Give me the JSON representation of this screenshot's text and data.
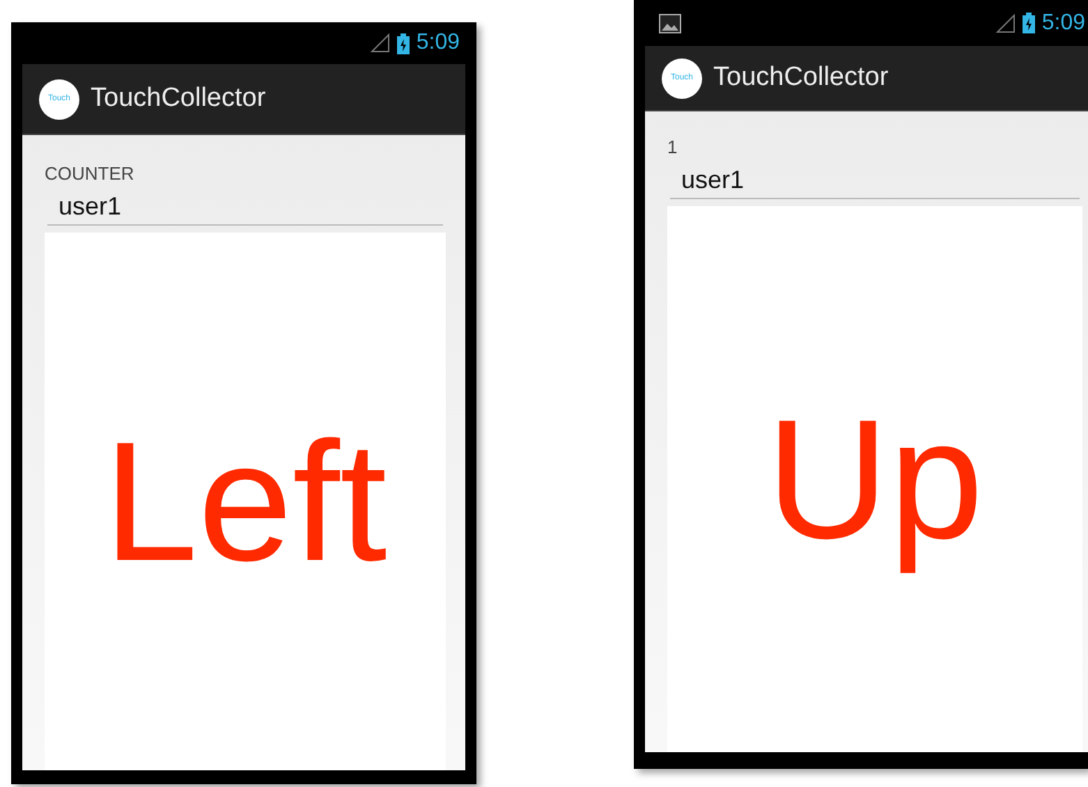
{
  "phones": [
    {
      "status_time": "5:09",
      "notification_icon": false,
      "app_title": "TouchCollector",
      "logo_text": "Touch",
      "counter": "COUNTER",
      "user_field": {
        "value": "user1"
      },
      "direction": "Left"
    },
    {
      "status_time": "5:09",
      "notification_icon": true,
      "app_title": "TouchCollector",
      "logo_text": "Touch",
      "counter": "1",
      "user_field": {
        "value": "user1"
      },
      "direction": "Up"
    }
  ]
}
